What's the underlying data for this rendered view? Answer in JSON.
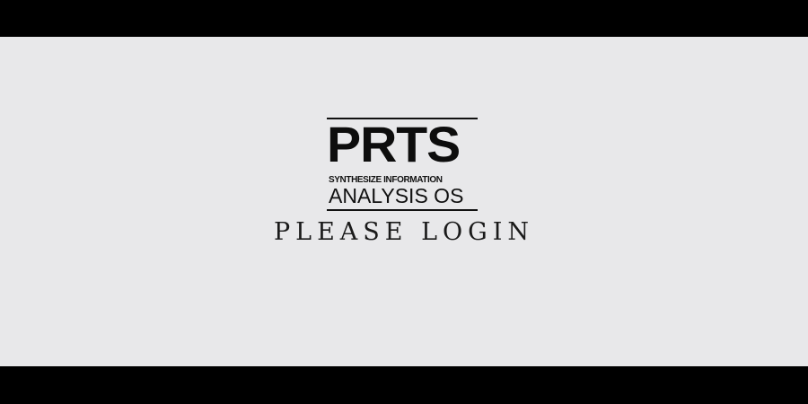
{
  "brand": {
    "title": "PRTS",
    "subtitle": "SYNTHESIZE INFORMATION",
    "os_line": "ANALYSIS  OS"
  },
  "prompt": {
    "text": "PLEASE LOGIN"
  },
  "colors": {
    "letterbox": "#000000",
    "background": "#e8e8ea",
    "text": "#111111"
  }
}
